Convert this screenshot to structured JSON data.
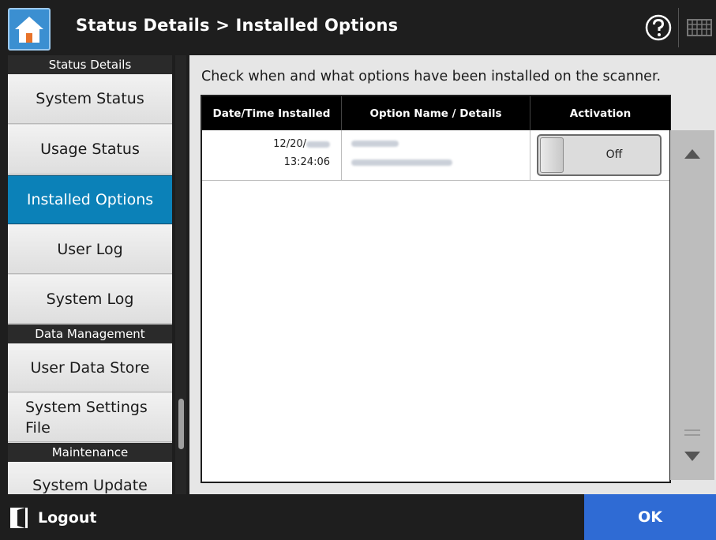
{
  "header": {
    "title": "Status Details > Installed Options",
    "home_icon": "home-icon",
    "help_icon": "help-icon",
    "keyboard_icon": "keyboard-icon"
  },
  "sidebar": {
    "sections": [
      {
        "label": "Status Details"
      },
      {
        "label": "Data Management"
      },
      {
        "label": "Maintenance"
      }
    ],
    "items": [
      {
        "label": "System Status"
      },
      {
        "label": "Usage Status"
      },
      {
        "label": "Installed Options",
        "active": true
      },
      {
        "label": "User Log"
      },
      {
        "label": "System Log"
      },
      {
        "label": "User Data Store"
      },
      {
        "label": "System Settings File"
      },
      {
        "label": "System Update"
      }
    ]
  },
  "main": {
    "description": "Check when and what options have been installed on the scanner.",
    "table": {
      "headers": [
        "Date/Time Installed",
        "Option Name / Details",
        "Activation"
      ],
      "rows": [
        {
          "date": "12/20/",
          "time": "13:24:06",
          "activation": "Off"
        }
      ]
    }
  },
  "footer": {
    "logout_label": "Logout",
    "ok_label": "OK"
  },
  "colors": {
    "accent": "#0b81b8",
    "ok_button": "#2f6bd4",
    "home_button": "#3b8fd1",
    "dark": "#1e1e1e"
  }
}
